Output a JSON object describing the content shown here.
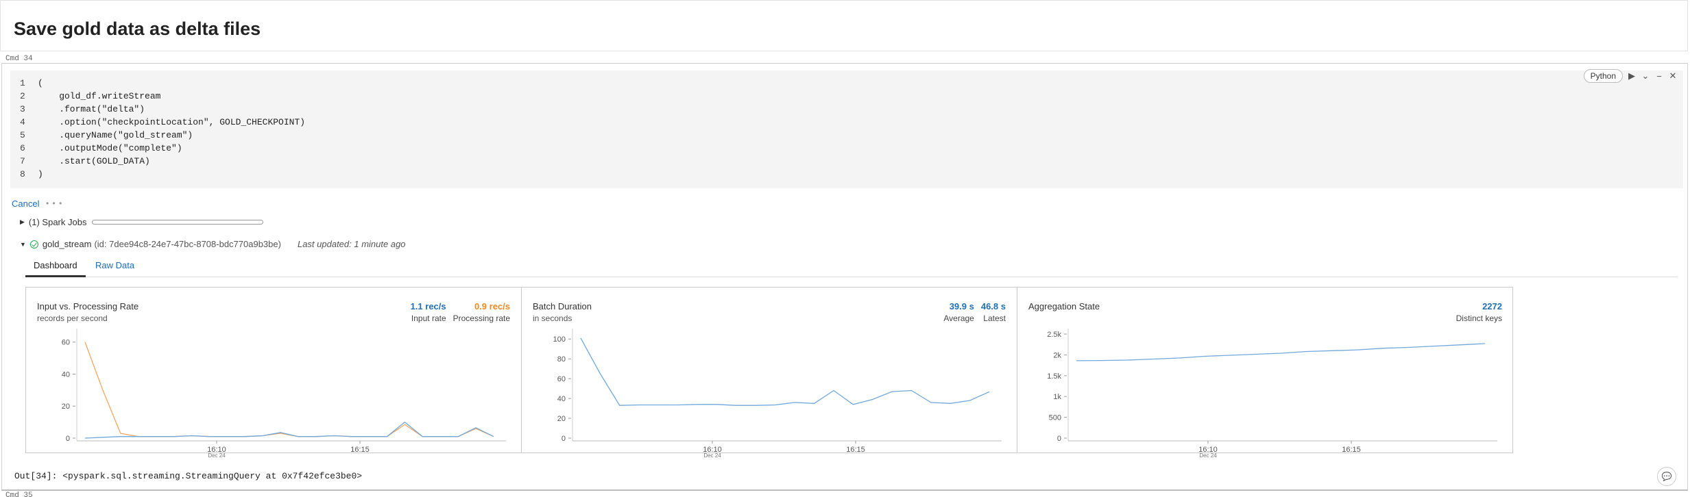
{
  "markdown": {
    "title": "Save gold data as delta files"
  },
  "cmd_labels": [
    "Cmd 34",
    "Cmd 35"
  ],
  "code": {
    "language": "Python",
    "lines": [
      {
        "num": "1",
        "text": "("
      },
      {
        "num": "2",
        "text": "    gold_df.writeStream"
      },
      {
        "num": "3",
        "text": "    .format(\"delta\")"
      },
      {
        "num": "4",
        "text": "    .option(\"checkpointLocation\", GOLD_CHECKPOINT)"
      },
      {
        "num": "5",
        "text": "    .queryName(\"gold_stream\")"
      },
      {
        "num": "6",
        "text": "    .outputMode(\"complete\")"
      },
      {
        "num": "7",
        "text": "    .start(GOLD_DATA)"
      },
      {
        "num": "8",
        "text": ")"
      }
    ]
  },
  "icons": {
    "run": "run-icon",
    "collapse": "chevron-down-icon",
    "minimize": "minimize-icon",
    "close": "close-icon",
    "ok": "check-circle-icon",
    "comment": "comment-icon"
  },
  "run_state": {
    "cancel_label": "Cancel",
    "spinner": "• • •"
  },
  "spark_jobs": {
    "label": "(1) Spark Jobs"
  },
  "stream": {
    "name": "gold_stream",
    "id_text": "(id: 7dee94c8-24e7-47bc-8708-bdc770a9b3be)",
    "updated": "Last updated: 1 minute ago"
  },
  "tabs": [
    {
      "label": "Dashboard"
    },
    {
      "label": "Raw Data"
    }
  ],
  "panels": [
    {
      "title": "Input vs. Processing Rate",
      "subtitle": "records per second",
      "metrics": [
        {
          "value": "1.1 rec/s",
          "label": "Input rate",
          "color": "#1f6fb5"
        },
        {
          "value": "0.9 rec/s",
          "label": "Processing rate",
          "color": "#f08a24"
        }
      ]
    },
    {
      "title": "Batch Duration",
      "subtitle": "in seconds",
      "metrics": [
        {
          "value": "39.9 s",
          "label": "Average",
          "color": "#1f6fb5"
        },
        {
          "value": "46.8 s",
          "label": "Latest",
          "color": "#1f6fb5"
        }
      ]
    },
    {
      "title": "Aggregation State",
      "subtitle": "",
      "metrics": [
        {
          "value": "2272",
          "label": "Distinct keys",
          "color": "#1f6fb5"
        }
      ]
    }
  ],
  "chart_data": [
    {
      "type": "line",
      "x_ticks": [
        "16:10",
        "16:15"
      ],
      "x_subtick": "Dec 24",
      "y_ticks": [
        "0",
        "20",
        "40",
        "60"
      ],
      "ylim": [
        0,
        65
      ],
      "series": [
        {
          "name": "Input rate",
          "color": "#6fa8dc",
          "values": [
            0,
            0.5,
            1,
            1,
            1,
            1,
            1.5,
            1,
            1,
            1,
            1.5,
            3.5,
            1,
            1,
            1.5,
            1,
            1,
            1,
            10,
            1,
            1,
            1,
            6.5,
            1
          ]
        },
        {
          "name": "Processing rate",
          "color": "#f5a55e",
          "values": [
            60,
            30,
            3,
            1,
            1,
            1,
            1.5,
            1,
            1,
            1,
            1.5,
            3,
            1,
            1,
            1.5,
            1,
            1,
            1,
            8.5,
            1,
            1,
            1,
            6,
            1
          ]
        }
      ]
    },
    {
      "type": "line",
      "x_ticks": [
        "16:10",
        "16:15"
      ],
      "x_subtick": "Dec 24",
      "y_ticks": [
        "0",
        "20",
        "40",
        "60",
        "80",
        "100"
      ],
      "ylim": [
        0,
        105
      ],
      "series": [
        {
          "name": "Batch duration",
          "color": "#6fa8dc",
          "values": [
            101,
            65,
            33,
            33.5,
            33.5,
            33.5,
            34,
            34,
            33,
            33,
            33.5,
            36,
            35,
            48,
            34,
            39,
            47,
            48,
            36,
            35,
            38,
            46.8
          ]
        }
      ]
    },
    {
      "type": "line",
      "x_ticks": [
        "16:10",
        "16:15"
      ],
      "x_subtick": "Dec 24",
      "y_ticks": [
        "0",
        "500",
        "1k",
        "1.5k",
        "2k",
        "2.5k"
      ],
      "ylim": [
        0,
        2500
      ],
      "series": [
        {
          "name": "Distinct keys",
          "color": "#6fa8dc",
          "values": [
            1860,
            1865,
            1875,
            1900,
            1925,
            1965,
            1990,
            2015,
            2040,
            2080,
            2100,
            2120,
            2160,
            2180,
            2210,
            2240,
            2272
          ]
        }
      ]
    }
  ],
  "output": {
    "text": "Out[34]: <pyspark.sql.streaming.StreamingQuery at 0x7f42efce3be0>"
  }
}
